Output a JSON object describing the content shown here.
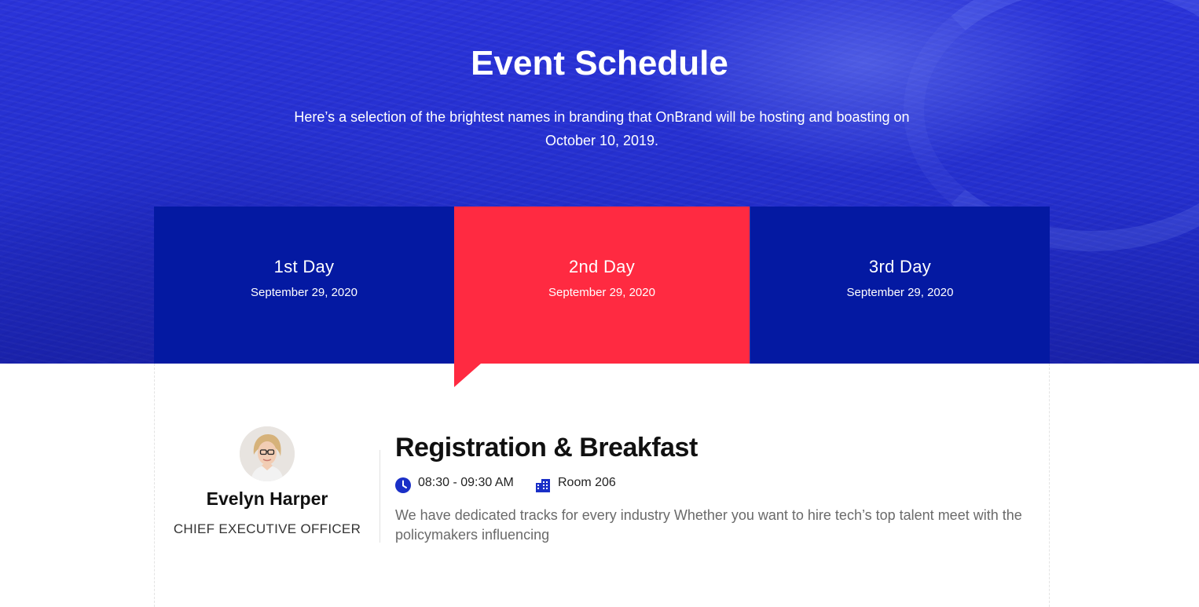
{
  "header": {
    "title": "Event Schedule",
    "subtitle": "Here’s a selection of the brightest names in branding that OnBrand will be hosting and boasting on October 10, 2019."
  },
  "tabs": [
    {
      "day": "1st Day",
      "date": "September 29, 2020",
      "active": false
    },
    {
      "day": "2nd Day",
      "date": "September 29, 2020",
      "active": true
    },
    {
      "day": "3rd Day",
      "date": "September 29, 2020",
      "active": false
    }
  ],
  "session": {
    "speaker": {
      "name": "Evelyn Harper",
      "role": "CHIEF EXECUTIVE OFFICER"
    },
    "title": "Registration & Breakfast",
    "time": "08:30 - 09:30 AM",
    "room": "Room 206",
    "description": "We have dedicated tracks for every industry Whether you want to hire tech’s top talent meet with the policymakers influencing"
  },
  "colors": {
    "hero_blue": "#2530cf",
    "tab_blue": "#0419a2",
    "tab_active": "#ff2a41",
    "icon_blue": "#1a2fc7"
  },
  "icons": {
    "time": "clock-icon",
    "room": "building-icon"
  }
}
